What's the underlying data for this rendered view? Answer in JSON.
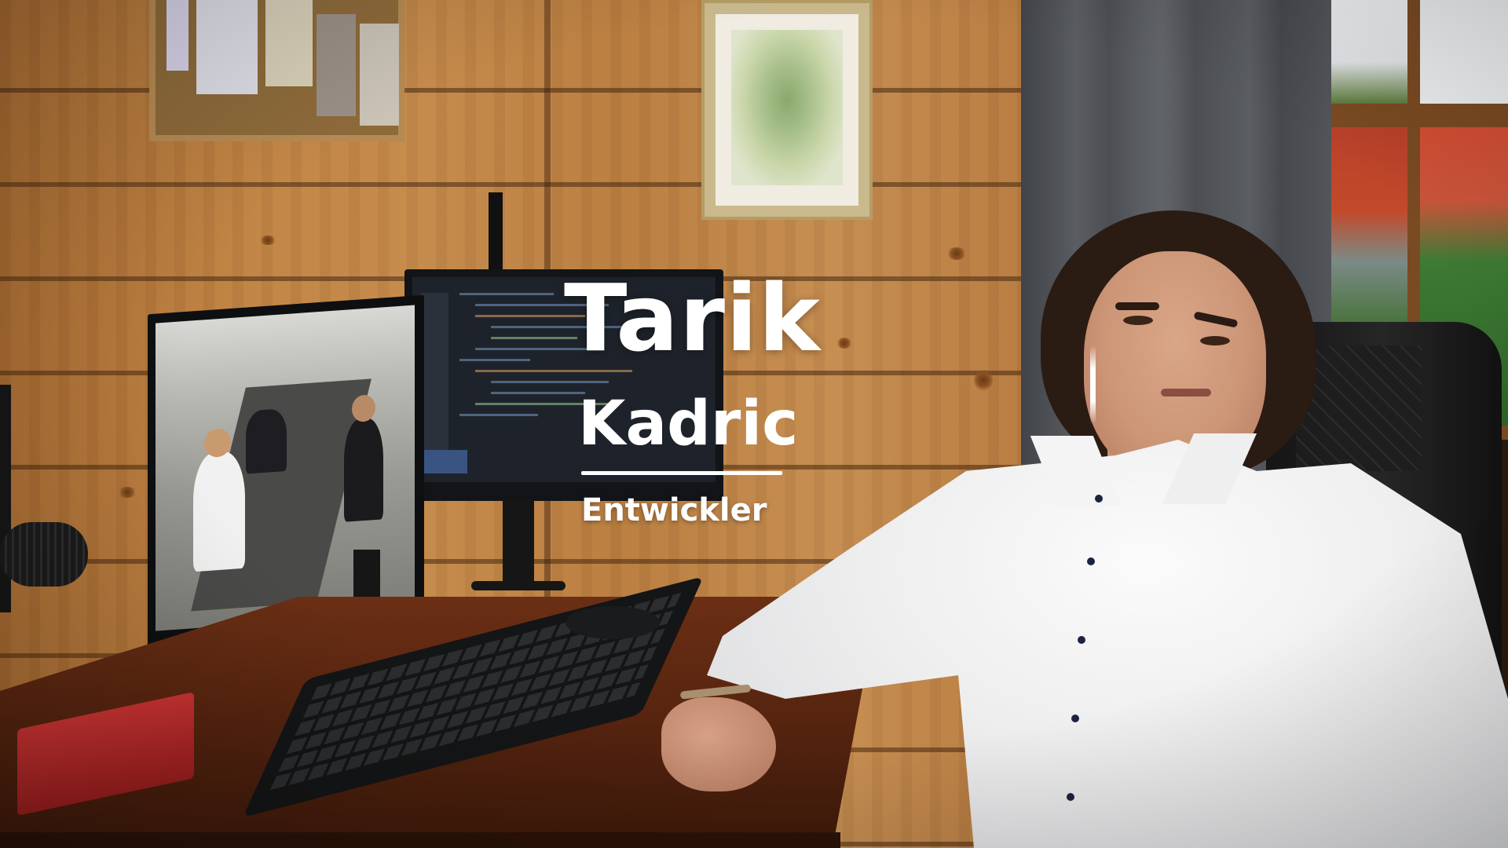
{
  "lower_third": {
    "first_name": "Tarik",
    "last_name": "Kadric",
    "role": "Entwickler",
    "text_color": "#ffffff"
  },
  "scene": {
    "wall_color": "#c08445",
    "curtain_color": "#4f5257",
    "shirt_color": "#eeeeef",
    "desk_color": "#5a2610"
  }
}
